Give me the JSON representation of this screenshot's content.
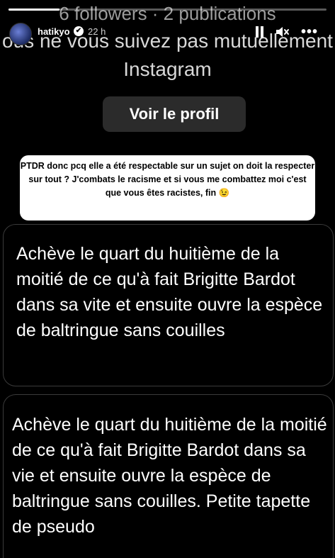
{
  "story": {
    "progress": 0.16,
    "background": {
      "followers_line": "6 followers · 2 publications",
      "mutual_line": "ous ne vous suivez pas mutuellement",
      "instagram_line": "Instagram"
    },
    "header": {
      "username": "hatikyo",
      "verified_glyph": "✔",
      "time": "22 h",
      "more_glyph": "•••"
    },
    "profile_button_label": "Voir le profil",
    "sticker_text": "PTDR donc pcq elle a été respectable sur un sujet on doit la respecter sur tout ? J'combats le racisme et si vous me combattez moi c'est que vous êtes racistes, fin 😉",
    "messages": [
      {
        "text": "Achève le quart du huitième de la moitié de ce qu'à fait Brigitte Bardot dans sa vite et ensuite ouvre la espèce de baltringue sans couilles"
      },
      {
        "text": "Achève le quart du huitième de la moitié de ce qu'à fait Brigitte Bardot dans sa vie et ensuite ouvre la espèce de baltringue sans couilles. Petite tapette de pseudo"
      }
    ]
  }
}
